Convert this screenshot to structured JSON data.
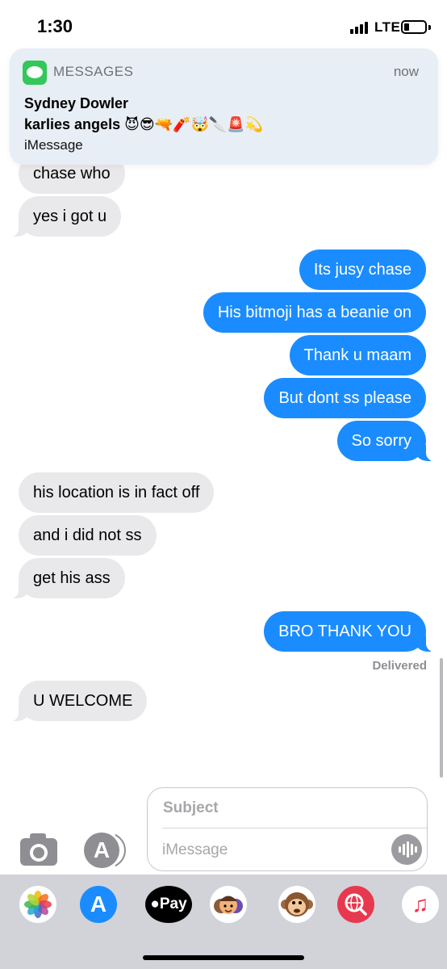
{
  "status_bar": {
    "time": "1:30",
    "network": "LTE"
  },
  "notification": {
    "app_name": "MESSAGES",
    "time": "now",
    "sender": "Sydney Dowler",
    "group_name": "karlies angels",
    "emoji_text": "😈😎🔫🧨🤯🔪🚨💫",
    "type": "iMessage",
    "icon": "messages-app-icon"
  },
  "messages": [
    {
      "direction": "in",
      "text": "chase who"
    },
    {
      "direction": "in",
      "text": "yes i got u"
    },
    {
      "direction": "out",
      "text": "Its jusy chase"
    },
    {
      "direction": "out",
      "text": "His bitmoji has a beanie on"
    },
    {
      "direction": "out",
      "text": "Thank u maam"
    },
    {
      "direction": "out",
      "text": "But dont ss please"
    },
    {
      "direction": "out",
      "text": "So sorry"
    },
    {
      "direction": "in",
      "text": "his location is in fact off"
    },
    {
      "direction": "in",
      "text": "and i did not ss"
    },
    {
      "direction": "in",
      "text": "get his ass"
    },
    {
      "direction": "out",
      "text": "BRO THANK YOU"
    },
    {
      "direction": "in",
      "text": "U WELCOME"
    }
  ],
  "delivered_label": "Delivered",
  "input": {
    "subject_placeholder": "Subject",
    "message_placeholder": "iMessage"
  },
  "app_drawer": {
    "apps": [
      {
        "name": "photos-icon",
        "label": ""
      },
      {
        "name": "app-store-icon",
        "label": ""
      },
      {
        "name": "apple-pay-icon",
        "label": "Pay"
      },
      {
        "name": "memoji-stickers-icon",
        "label": ""
      },
      {
        "name": "animoji-icon",
        "label": ""
      },
      {
        "name": "web-search-icon",
        "label": ""
      },
      {
        "name": "music-icon",
        "label": ""
      }
    ]
  },
  "colors": {
    "outgoing_bubble": "#1a8cff",
    "incoming_bubble": "#e9e9eb",
    "drawer_background": "#d1d3d9"
  }
}
